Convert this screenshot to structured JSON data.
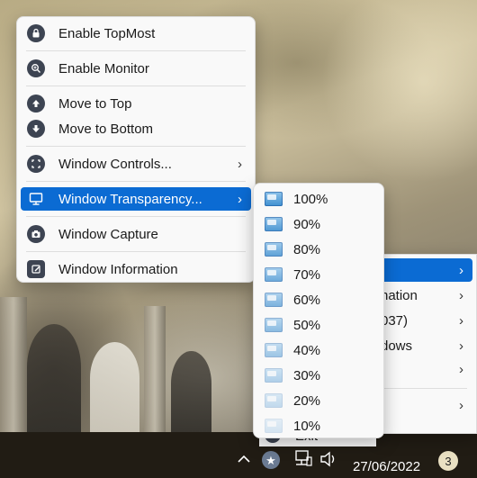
{
  "main_menu": {
    "items": [
      {
        "label": "Enable TopMost",
        "icon": "lock-icon"
      },
      {
        "label": "Enable Monitor",
        "icon": "zoom-in-icon"
      },
      {
        "label": "Move to Top",
        "icon": "arrow-up-icon"
      },
      {
        "label": "Move to Bottom",
        "icon": "arrow-down-icon"
      },
      {
        "label": "Window Controls...",
        "icon": "window-controls-icon",
        "chevron": "›"
      },
      {
        "label": "Window Transparency...",
        "icon": "monitor-icon",
        "chevron": "›",
        "highlighted": true
      },
      {
        "label": "Window Capture",
        "icon": "camera-icon"
      },
      {
        "label": "Window Information",
        "icon": "edit-note-icon"
      }
    ]
  },
  "transparency_submenu": {
    "items": [
      "100%",
      "90%",
      "80%",
      "70%",
      "60%",
      "50%",
      "40%",
      "30%",
      "20%",
      "10%"
    ]
  },
  "back_menu": {
    "items": [
      {
        "label": "",
        "chevron": "›",
        "highlighted": true
      },
      {
        "label": "nation",
        "chevron": "›"
      },
      {
        "label": "037)",
        "chevron": "›"
      },
      {
        "label": "dows",
        "chevron": "›"
      },
      {
        "label": "",
        "chevron": "›"
      },
      {
        "label": "",
        "chevron": "›"
      },
      {
        "label": "Exit",
        "chevron": ""
      }
    ]
  },
  "taskbar": {
    "show_hidden_icon": "chevron-up-icon",
    "date": "27/06/2022",
    "notification_count": "3"
  },
  "colors": {
    "highlight": "#0b6bd3",
    "taskbar": "#211c14",
    "menu_bg": "#f9f9f9"
  }
}
